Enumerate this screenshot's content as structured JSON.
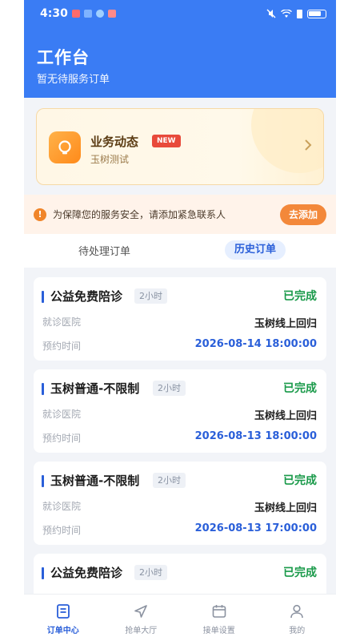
{
  "status_bar": {
    "time": "4:30"
  },
  "header": {
    "title": "工作台",
    "subtitle": "暂无待服务订单"
  },
  "promo": {
    "title": "业务动态",
    "badge": "NEW",
    "desc": "玉树测试"
  },
  "notice": {
    "text": "为保障您的服务安全，请添加紧急联系人",
    "button": "去添加"
  },
  "tabs": {
    "pending": "待处理订单",
    "history": "历史订单",
    "active": "history"
  },
  "labels": {
    "hospital": "就诊医院",
    "time": "预约时间"
  },
  "orders": [
    {
      "title": "公益免费陪诊",
      "duration": "2小时",
      "status": "已完成",
      "hospital": "玉树线上回归",
      "time": "2026-08-14 18:00:00"
    },
    {
      "title": "玉树普通-不限制",
      "duration": "2小时",
      "status": "已完成",
      "hospital": "玉树线上回归",
      "time": "2026-08-13 18:00:00"
    },
    {
      "title": "玉树普通-不限制",
      "duration": "2小时",
      "status": "已完成",
      "hospital": "玉树线上回归",
      "time": "2026-08-13 17:00:00"
    },
    {
      "title": "公益免费陪诊",
      "duration": "2小时",
      "status": "已完成",
      "hospital": "",
      "time": ""
    }
  ],
  "nav": [
    {
      "label": "订单中心",
      "icon": "order-list-icon"
    },
    {
      "label": "抢单大厅",
      "icon": "navigation-arrow-icon"
    },
    {
      "label": "接单设置",
      "icon": "calendar-icon"
    },
    {
      "label": "我的",
      "icon": "person-icon"
    }
  ],
  "colors": {
    "primary": "#3a7cf4",
    "success": "#1a9a4a",
    "accent": "#f3883a",
    "badge": "#e84a3b"
  }
}
